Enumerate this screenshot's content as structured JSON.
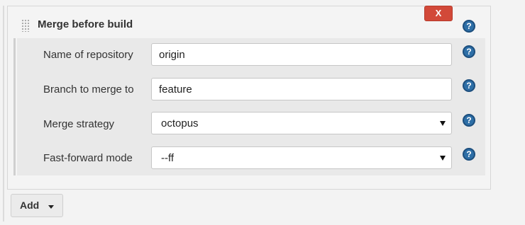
{
  "section": {
    "title": "Merge before build",
    "close_label": "X"
  },
  "fields": [
    {
      "label": "Name of repository",
      "type": "text",
      "value": "origin"
    },
    {
      "label": "Branch to merge to",
      "type": "text",
      "value": "feature"
    },
    {
      "label": "Merge strategy",
      "type": "select",
      "value": "octopus"
    },
    {
      "label": "Fast-forward mode",
      "type": "select",
      "value": "--ff"
    }
  ],
  "help_icon_glyph": "?",
  "add_button": {
    "label": "Add"
  },
  "colors": {
    "close_button": "#d24939",
    "help_icon": "#2e6fa7"
  }
}
